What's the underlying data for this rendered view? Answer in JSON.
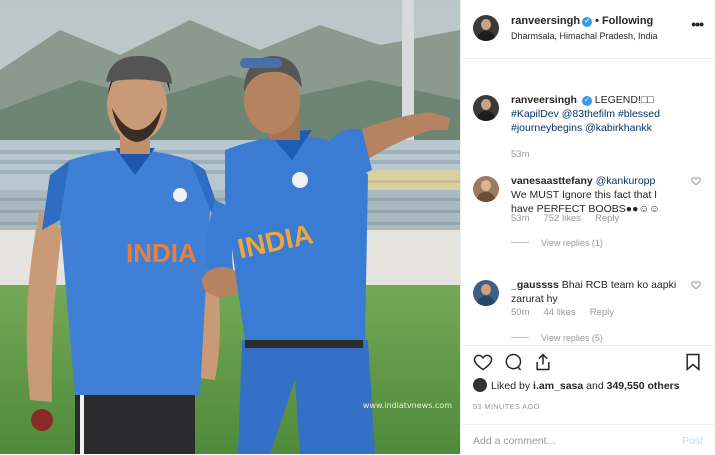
{
  "header": {
    "username": "ranveersingh",
    "follow_label": "Following",
    "location": "Dharmsala, Himachal Pradesh, India"
  },
  "photo": {
    "jersey_text_left": "INDIA",
    "jersey_text_right": "INDIA",
    "watermark": "www.indiatvnews.com"
  },
  "caption": {
    "username": "ranveersingh",
    "text_lead": "LEGEND!□□",
    "tags_line1": "#KapilDev @83thefilm #blessed",
    "tags_line2": "#journeybegins @kabirkhankk",
    "time": "53m"
  },
  "comments": [
    {
      "username": "vanesaasttefany",
      "mention": "@kankuropp",
      "text_line1": "We MUST Ignore this fact that I",
      "text_line2": "have PERFECT BOOBS●●☺☺",
      "time": "53m",
      "likes": "752 likes",
      "reply": "Reply",
      "view_replies": "View replies (1)"
    },
    {
      "username": "_gaussss",
      "text_line1": "Bhai RCB team ko aapki",
      "text_line2": "zarurat hy",
      "time": "50m",
      "likes": "44 likes",
      "reply": "Reply",
      "view_replies": "View replies (5)"
    }
  ],
  "likes": {
    "liked_by": "Liked by",
    "user": "i.am_sasa",
    "and": "and",
    "count": "349,550 others"
  },
  "timestamp": "53 MINUTES AGO",
  "add_comment": {
    "placeholder": "Add a comment...",
    "post_label": "Post"
  },
  "icons": [
    "heart-icon",
    "comment-icon",
    "share-icon",
    "bookmark-icon",
    "more-options-icon",
    "verified-icon"
  ],
  "colors": {
    "link": "#003569",
    "verified": "#3897f0",
    "post": "#b2dffc",
    "jersey": "#3f7fd6"
  }
}
